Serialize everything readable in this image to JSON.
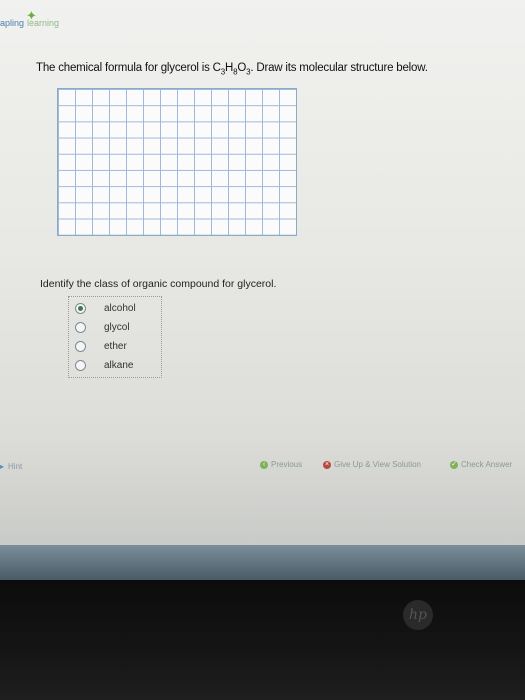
{
  "brand": {
    "part1": "apling",
    "part2": "learning"
  },
  "question": {
    "prefix": "The chemical formula for glycerol is C",
    "sub1": "3",
    "mid1": "H",
    "sub2": "8",
    "mid2": "O",
    "sub3": "3",
    "suffix": ". Draw its molecular structure below."
  },
  "mcq": {
    "prompt": "Identify the class of organic compound for glycerol.",
    "options": [
      {
        "label": "alcohol",
        "selected": true
      },
      {
        "label": "glycol",
        "selected": false
      },
      {
        "label": "ether",
        "selected": false
      },
      {
        "label": "alkane",
        "selected": false
      }
    ]
  },
  "hint": {
    "label": "Hint"
  },
  "footer": {
    "previous": "Previous",
    "give_up": "Give Up & View Solution",
    "check": "Check Answer"
  },
  "device": {
    "logo": "hp"
  }
}
